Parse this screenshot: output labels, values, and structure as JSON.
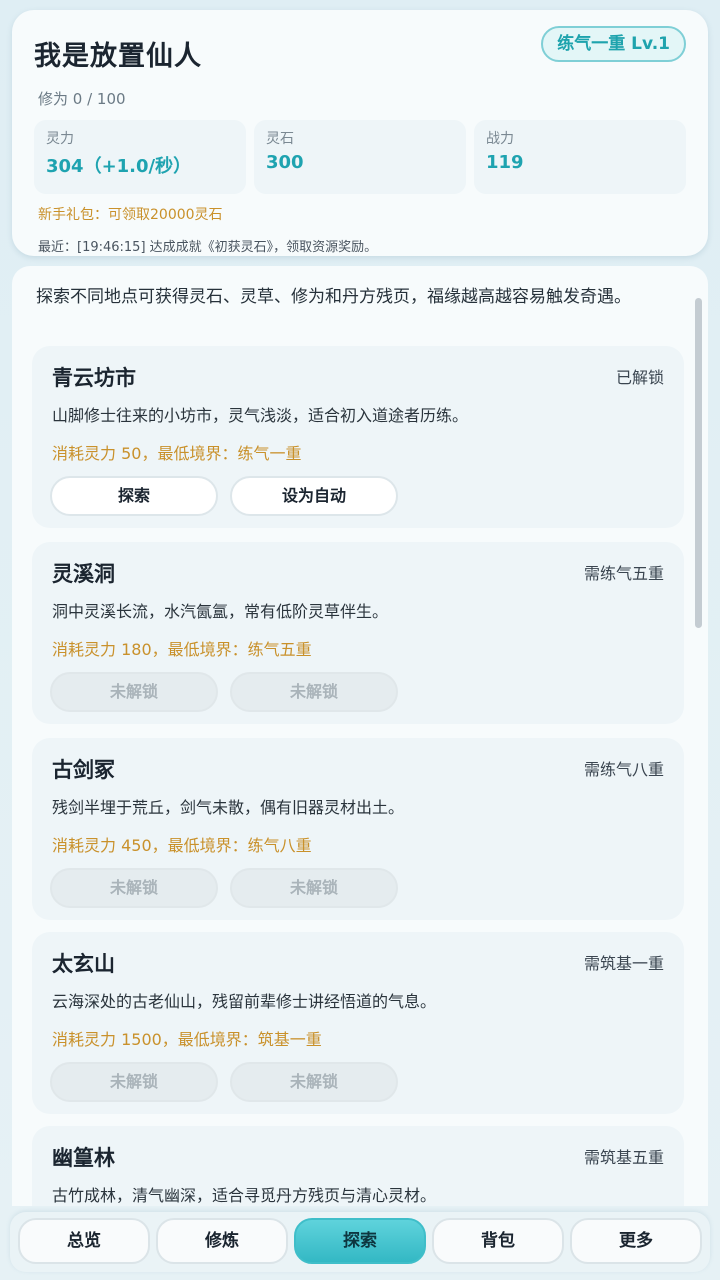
{
  "header": {
    "title": "我是放置仙人",
    "realm_badge": "练气一重  Lv.1",
    "cultivation": "修为 0 / 100",
    "stats": [
      {
        "label": "灵力",
        "value": "304（+1.0/秒）"
      },
      {
        "label": "灵石",
        "value": "300"
      },
      {
        "label": "战力",
        "value": "119"
      }
    ],
    "gift": "新手礼包：可领取20000灵石",
    "recent": "最近：[19:46:15] 达成成就《初获灵石》，领取资源奖励。"
  },
  "main": {
    "intro": "探索不同地点可获得灵石、灵草、修为和丹方残页，福缘越高越容易触发奇遇。",
    "locations": [
      {
        "name": "青云坊市",
        "status": "已解锁",
        "desc": "山脚修士往来的小坊市，灵气浅淡，适合初入道途者历练。",
        "cost": "消耗灵力 50，最低境界：练气一重",
        "btn1": "探索",
        "btn2": "设为自动"
      },
      {
        "name": "灵溪洞",
        "status": "需练气五重",
        "desc": "洞中灵溪长流，水汽氤氲，常有低阶灵草伴生。",
        "cost": "消耗灵力 180，最低境界：练气五重",
        "btn1": "未解锁",
        "btn2": "未解锁"
      },
      {
        "name": "古剑冢",
        "status": "需练气八重",
        "desc": "残剑半埋于荒丘，剑气未散，偶有旧器灵材出土。",
        "cost": "消耗灵力 450，最低境界：练气八重",
        "btn1": "未解锁",
        "btn2": "未解锁"
      },
      {
        "name": "太玄山",
        "status": "需筑基一重",
        "desc": "云海深处的古老仙山，残留前辈修士讲经悟道的气息。",
        "cost": "消耗灵力 1500，最低境界：筑基一重",
        "btn1": "未解锁",
        "btn2": "未解锁"
      },
      {
        "name": "幽篁林",
        "status": "需筑基五重",
        "desc": "古竹成林，清气幽深，适合寻觅丹方残页与清心灵材。"
      }
    ]
  },
  "nav": {
    "items": [
      "总览",
      "修炼",
      "探索",
      "背包",
      "更多"
    ],
    "active": "探索"
  },
  "colors": {
    "accent": "#33b8c4",
    "gold": "#c9912b",
    "background": "#e6f1f5"
  }
}
